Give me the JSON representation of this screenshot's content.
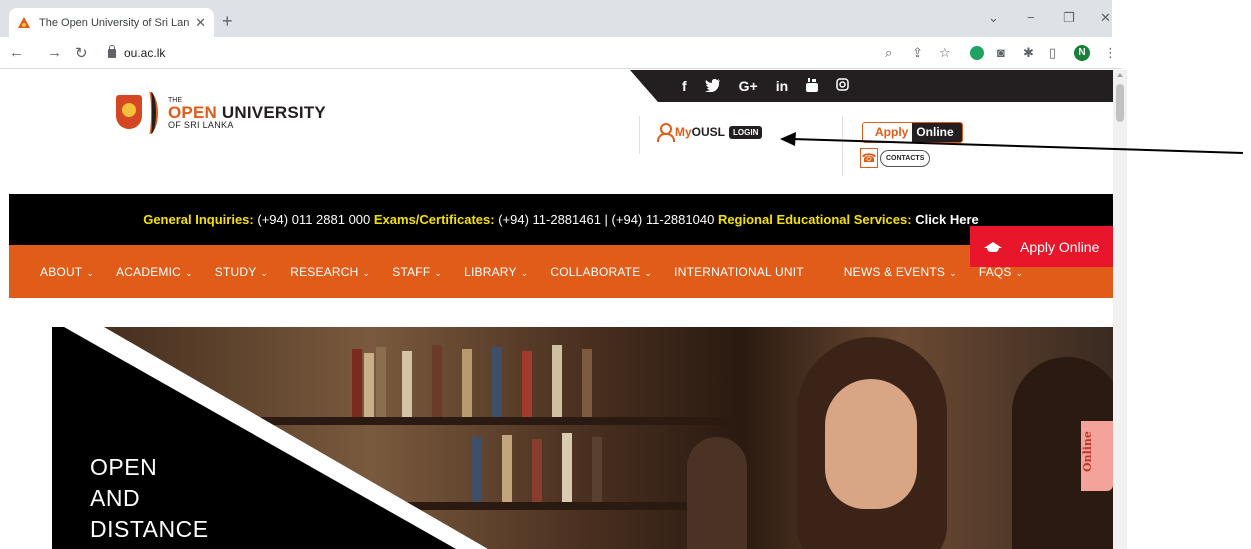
{
  "browser": {
    "tab_title": "The Open University of Sri Lanka",
    "tab_close": "✕",
    "new_tab": "+",
    "url": "ou.ac.lk",
    "profile_initial": "N"
  },
  "header": {
    "social_icons": [
      "f",
      "🐦",
      "G+",
      "in",
      "▶",
      "◎"
    ],
    "logo_the": "THE",
    "logo_open": "OPEN",
    "logo_university": "UNIVERSITY",
    "logo_sub": "OF SRI LANKA",
    "myousl_my": "My",
    "myousl_ousl": "OUSL",
    "myousl_login": "LOGIN",
    "apply_a": "Apply",
    "apply_o": "Online",
    "contacts": "CONTACTS"
  },
  "infobar": {
    "general_label": "General Inquiries:",
    "general_value": "(+94) 011 2881 000",
    "exams_label": "Exams/Certificates:",
    "exams_value": "(+94) 11-2881461 | (+94) 11-2881040",
    "regional_label": "Regional Educational Services:",
    "regional_value": "Click Here"
  },
  "nav": {
    "items": [
      "ABOUT",
      "ACADEMIC",
      "STUDY",
      "RESEARCH",
      "STAFF",
      "LIBRARY",
      "COLLABORATE",
      "INTERNATIONAL UNIT",
      "NEWS & EVENTS",
      "FAQS"
    ]
  },
  "float_apply": "Apply Online",
  "hero": {
    "line1": "OPEN",
    "line2": "AND",
    "line3": "DISTANCE"
  },
  "side_tab": "Online",
  "colors": {
    "brand_orange": "#e25c19",
    "brand_dark": "#231f20",
    "highlight_yellow": "#f4e000",
    "apply_red": "#e8162a"
  }
}
